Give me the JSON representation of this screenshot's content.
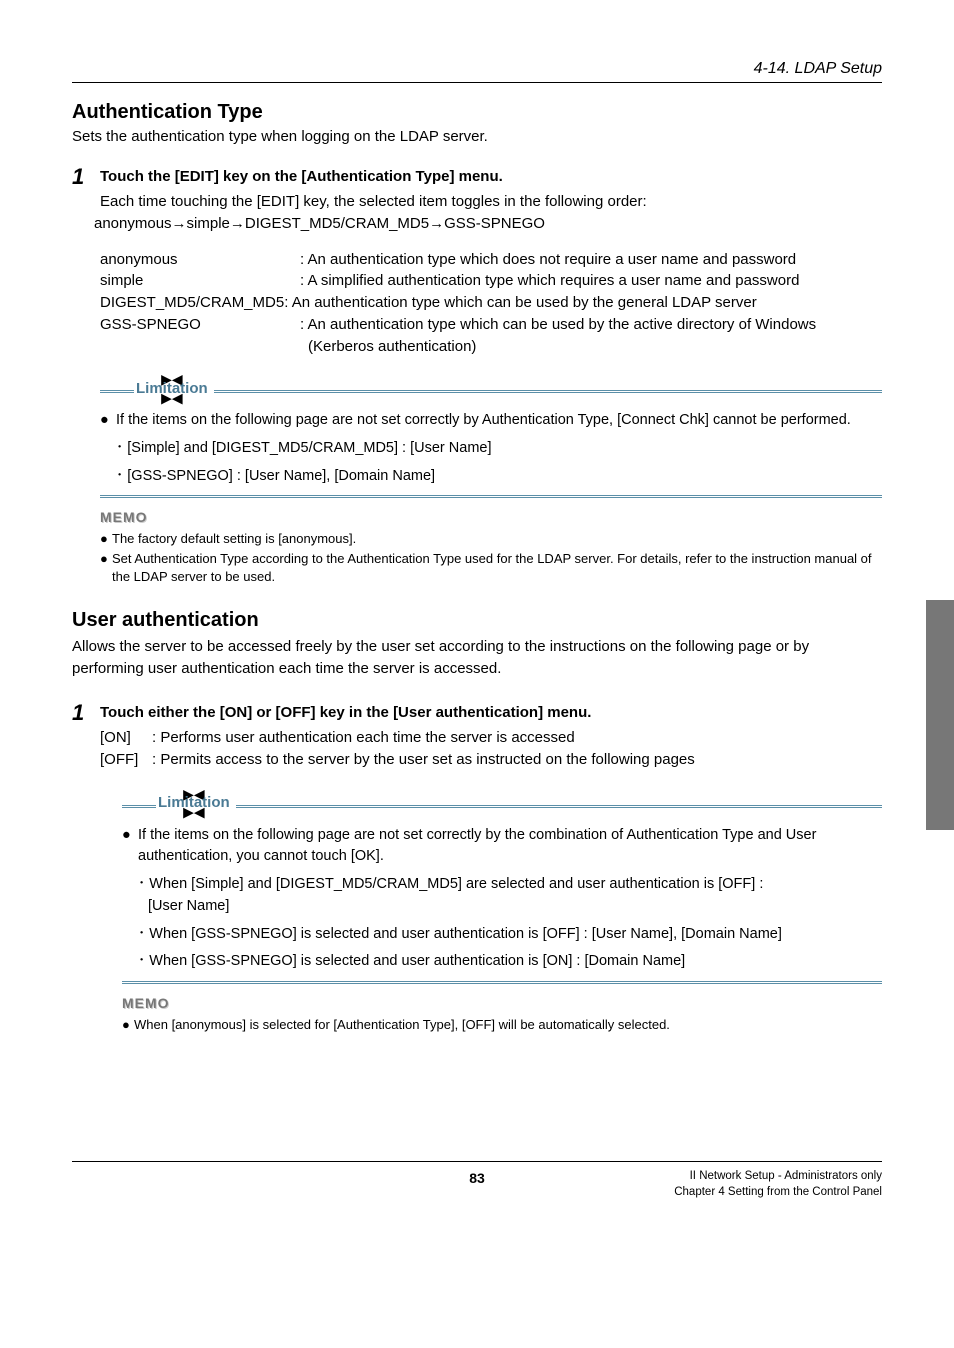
{
  "header": {
    "section": "4-14. LDAP Setup"
  },
  "auth": {
    "title": "Authentication Type",
    "intro": "Sets the authentication type when logging on the LDAP server.",
    "step_num": "1",
    "step_text": "Touch the [EDIT] key on the [Authentication Type] menu.",
    "step_body_1": "Each time touching the [EDIT] key, the selected item toggles in the following order:",
    "step_body_2": "anonymous→simple→DIGEST_MD5/CRAM_MD5→GSS-SPNEGO",
    "defs": {
      "anonymous_t": "anonymous",
      "anonymous_d": ": An authentication type which does not require a user name and password",
      "simple_t": "simple",
      "simple_d": ": A simplified authentication type which requires a user name and password",
      "digest_line": "DIGEST_MD5/CRAM_MD5: An authentication type which can be used by the general LDAP server",
      "gss_t": "GSS-SPNEGO",
      "gss_d1": ": An authentication type which can be used by the active directory of Windows",
      "gss_d2": "(Kerberos authentication)"
    },
    "limitation": {
      "label": "Limitation",
      "bullet": "If the items on the following page are not set correctly by Authentication Type, [Connect Chk] cannot be performed.",
      "sub1": "･ [Simple] and [DIGEST_MD5/CRAM_MD5] : [User Name]",
      "sub2": "･ [GSS-SPNEGO] : [User Name], [Domain Name]"
    },
    "memo": {
      "label": "MEMO",
      "m1": "The factory default setting is [anonymous].",
      "m2": "Set Authentication Type according to the Authentication Type used for the LDAP server. For details, refer to the instruction manual of the LDAP server to be used."
    }
  },
  "user": {
    "title": "User authentication",
    "intro": "Allows the server to be accessed freely by the user set according to the instructions on the following page or by performing user authentication each time the server is accessed.",
    "step_num": "1",
    "step_text": "Touch either the [ON] or [OFF] key in the [User authentication] menu.",
    "on_key": "[ON]",
    "on_desc": ": Performs user authentication each time the server is accessed",
    "off_key": "[OFF]",
    "off_desc": ": Permits access to the server by the user set as instructed on the following pages",
    "limitation": {
      "label": "Limitation",
      "bullet": "If the items on the following page are not set correctly by the combination of Authentication Type and User authentication, you cannot touch [OK].",
      "sub1a": "･ When [Simple] and [DIGEST_MD5/CRAM_MD5] are selected and user authentication is [OFF] :",
      "sub1b": "[User Name]",
      "sub2": "･ When [GSS-SPNEGO] is selected and user authentication is [OFF] : [User Name], [Domain Name]",
      "sub3": "･ When [GSS-SPNEGO] is selected and user authentication is [ON] : [Domain Name]"
    },
    "memo": {
      "label": "MEMO",
      "m1": "When [anonymous] is selected for [Authentication Type], [OFF] will be automatically selected."
    }
  },
  "footer": {
    "page": "83",
    "right1": "II Network Setup - Administrators only",
    "right2": "Chapter 4 Setting from the Control Panel"
  }
}
